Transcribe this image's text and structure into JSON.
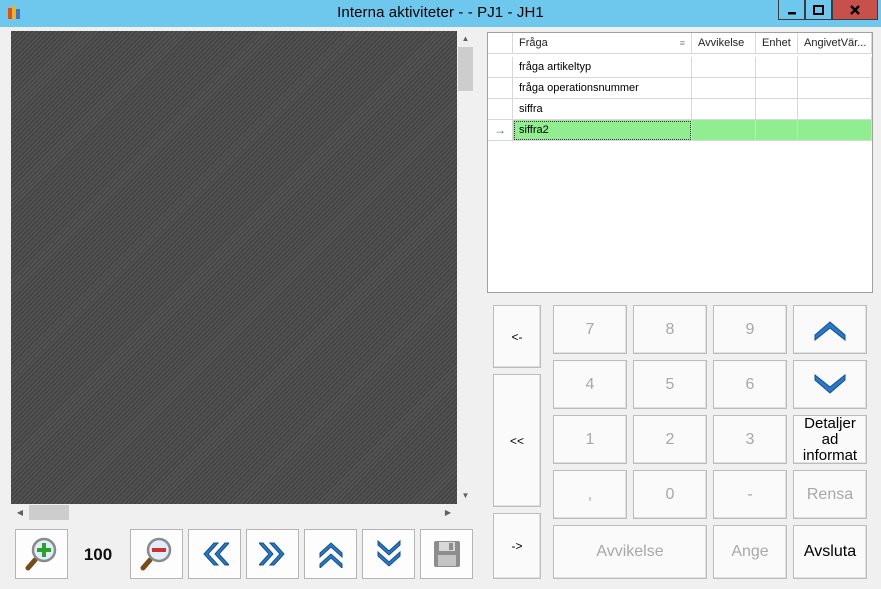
{
  "window": {
    "title": "Interna aktiviteter -  - PJ1 - JH1"
  },
  "viewer": {
    "zoom": "100"
  },
  "grid": {
    "columns": [
      "Fråga",
      "Avvikelse",
      "Enhet",
      "AngivetVär..."
    ],
    "rows": [
      {
        "indicator": "",
        "fraga": "fråga artikeltyp",
        "avvikelse": "",
        "enhet": "",
        "angivet": ""
      },
      {
        "indicator": "",
        "fraga": "fråga operationsnummer",
        "avvikelse": "",
        "enhet": "",
        "angivet": ""
      },
      {
        "indicator": "",
        "fraga": "siffra",
        "avvikelse": "",
        "enhet": "",
        "angivet": ""
      },
      {
        "indicator": "→",
        "fraga": "siffra2",
        "avvikelse": "",
        "enhet": "",
        "angivet": ""
      }
    ],
    "selected_row": 3,
    "selected_color": "#90ee90"
  },
  "keypad": {
    "back": "<-",
    "start": "<<",
    "forward": "->",
    "k7": "7",
    "k8": "8",
    "k9": "9",
    "k4": "4",
    "k5": "5",
    "k6": "6",
    "k1": "1",
    "k2": "2",
    "k3": "3",
    "comma": ",",
    "k0": "0",
    "minus": "-",
    "detail": "Detaljer ad informat",
    "clear": "Rensa",
    "deviation": "Avvikelse",
    "enter": "Ange",
    "exit": "Avsluta"
  },
  "icons": {
    "zoom_in": "zoom-in-icon",
    "zoom_out": "zoom-out-icon",
    "prev_page": "double-chevron-left-icon",
    "next_page": "double-chevron-right-icon",
    "first": "double-chevron-up-icon",
    "last": "double-chevron-down-icon",
    "save": "floppy-disk-icon",
    "up": "chevron-up-icon",
    "down": "chevron-down-icon"
  },
  "colors": {
    "titlebar": "#6ec8ee",
    "close": "#c7504a",
    "icon_blue": "#2a78c8"
  }
}
